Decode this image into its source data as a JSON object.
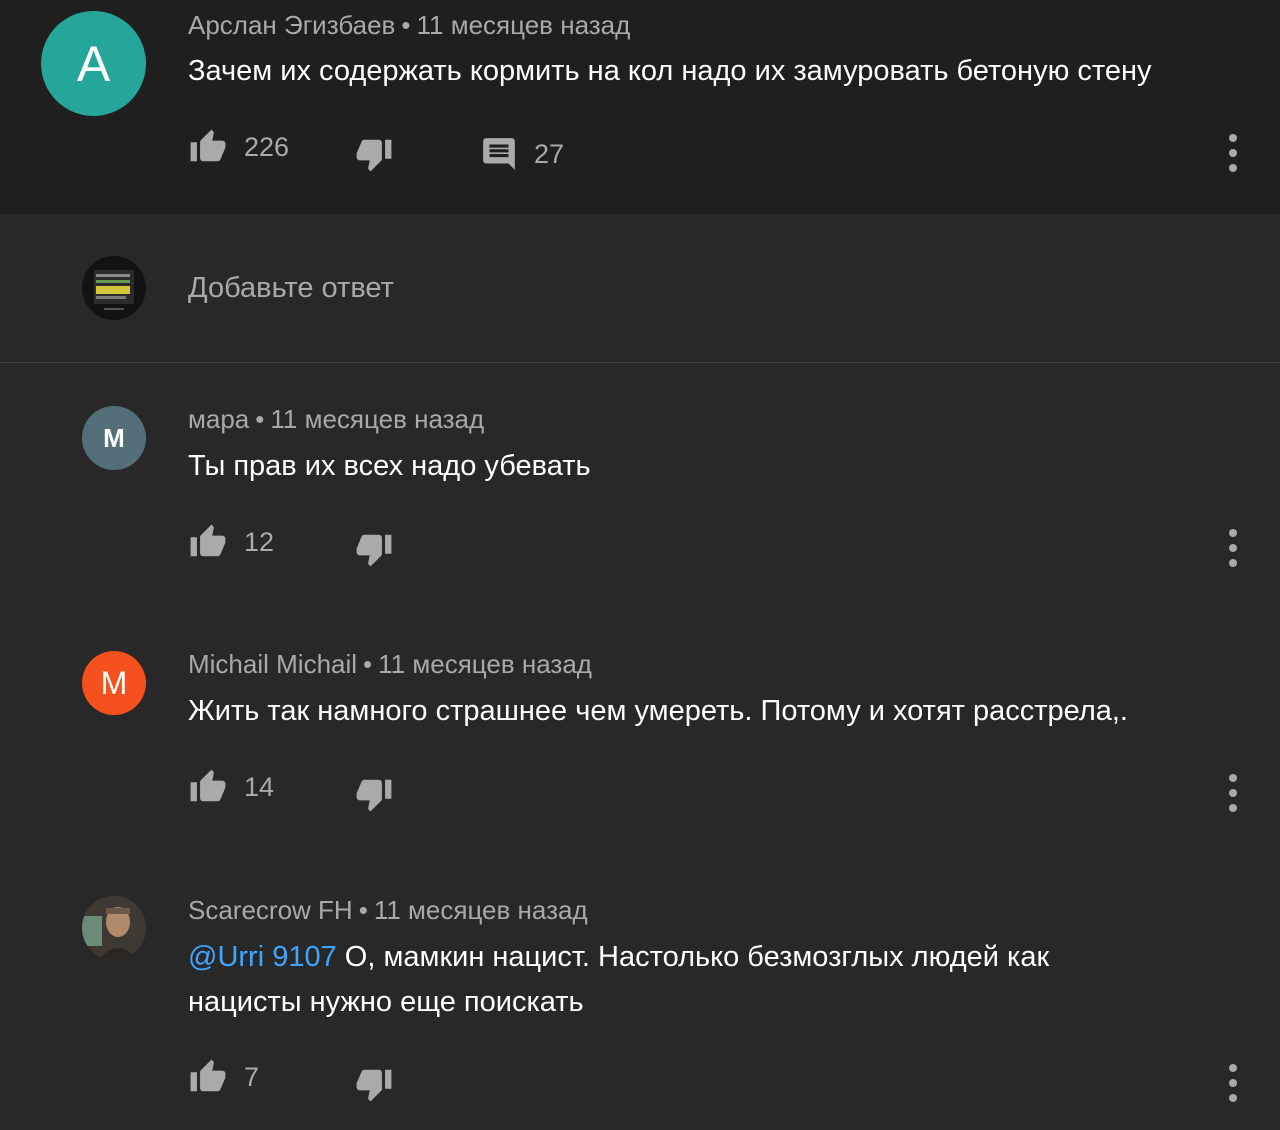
{
  "top_comment": {
    "avatar_letter": "А",
    "avatar_color": "#26a69a",
    "author": "Арслан Эгизбаев",
    "time": "11 месяцев назад",
    "text": "Зачем их содержать кормить на кол надо их замуровать бетоную стену",
    "likes": "226",
    "replies": "27"
  },
  "reply_input": {
    "placeholder": "Добавьте ответ"
  },
  "replies": [
    {
      "avatar_letter": "М",
      "avatar_color": "#546e7a",
      "author": "мара",
      "time": "11 месяцев назад",
      "text": "Ты прав их всех надо убевать",
      "likes": "12"
    },
    {
      "avatar_letter": "M",
      "avatar_color": "#f4511e",
      "author": "Michail Michail",
      "time": "11 месяцев назад",
      "text": "Жить так намного страшнее чем умереть. Потому и хотят расстрела,.",
      "likes": "14"
    },
    {
      "author": "Scarecrow FH",
      "time": "11 месяцев назад",
      "mention": "@Urri 9107",
      "text_line1": " О, мамкин нацист. Настолько безмозглых людей как",
      "text_line2": "нацисты нужно еще поискать",
      "likes": "7"
    }
  ],
  "separator": "•",
  "colors": {
    "background": "#282828",
    "highlight_background": "#1f1f1f",
    "meta_text": "#a9a9a9",
    "mention": "#3ea6ff"
  }
}
